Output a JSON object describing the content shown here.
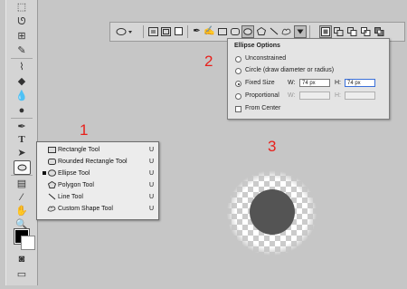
{
  "annotations": [
    "1",
    "2",
    "3"
  ],
  "toolbar": {
    "tools": [
      "marquee-icon",
      "lasso-icon",
      "crop-icon",
      "eyedropper-icon",
      "brush-icon",
      "eraser-icon",
      "gradient-icon",
      "blur-icon",
      "dodge-icon",
      "pen-icon",
      "type-icon",
      "path-select-icon",
      "ellipse-tool-icon",
      "notes-icon",
      "eyedropper2-icon",
      "hand-icon",
      "zoom-icon"
    ],
    "active_tool": "ellipse-tool-icon",
    "foreground_color": "#000000",
    "background_color": "#ffffff"
  },
  "flyout": {
    "items": [
      {
        "label": "Rectangle Tool",
        "key": "U",
        "icon": "rectangle-icon",
        "selected": false
      },
      {
        "label": "Rounded Rectangle Tool",
        "key": "U",
        "icon": "rounded-rectangle-icon",
        "selected": false
      },
      {
        "label": "Ellipse Tool",
        "key": "U",
        "icon": "ellipse-icon",
        "selected": true
      },
      {
        "label": "Polygon Tool",
        "key": "U",
        "icon": "polygon-icon",
        "selected": false
      },
      {
        "label": "Line Tool",
        "key": "U",
        "icon": "line-icon",
        "selected": false
      },
      {
        "label": "Custom Shape Tool",
        "key": "U",
        "icon": "custom-shape-icon",
        "selected": false
      }
    ]
  },
  "options_bar": {
    "buttons": [
      "tool-preset-icon",
      "shape-layers-icon",
      "paths-icon",
      "fill-pixels-icon",
      "pen-icon",
      "freeform-pen-icon",
      "rectangle-icon",
      "rounded-rectangle-icon",
      "ellipse-icon",
      "polygon-icon",
      "line-icon",
      "custom-shape-icon",
      "geometry-options-icon",
      "new-layer-icon",
      "add-icon",
      "subtract-icon",
      "intersect-icon",
      "exclude-icon"
    ],
    "active": "ellipse-icon"
  },
  "ellipse_options": {
    "title": "Ellipse Options",
    "options": [
      {
        "label": "Unconstrained",
        "selected": false
      },
      {
        "label": "Circle (draw diameter or radius)",
        "selected": false
      },
      {
        "label": "Fixed Size",
        "selected": true
      },
      {
        "label": "Proportional",
        "selected": false
      }
    ],
    "fixed_w_label": "W:",
    "fixed_w_value": "74 px",
    "fixed_h_label": "H:",
    "fixed_h_value": "74 px",
    "prop_w_label": "W:",
    "prop_h_label": "H:",
    "from_center_label": "From Center",
    "from_center_checked": false
  },
  "canvas": {
    "shape": "circle",
    "shape_color": "#545454"
  },
  "colors": {
    "annotation": "#e8201b",
    "background": "#c6c6c6"
  }
}
